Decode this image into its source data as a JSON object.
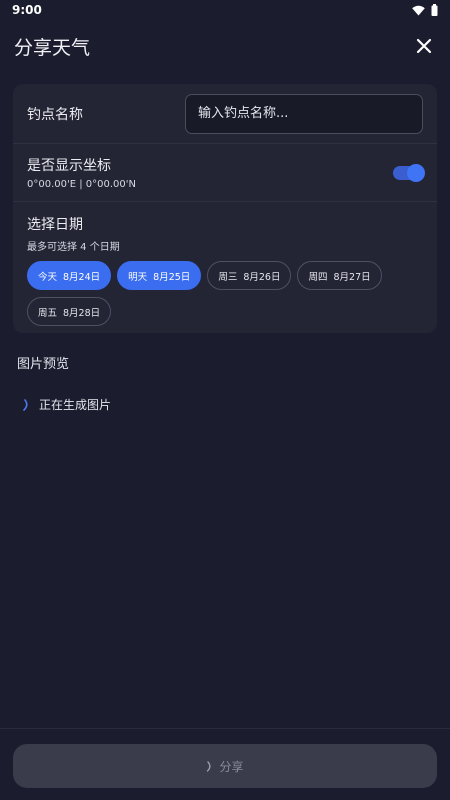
{
  "status_bar": {
    "time": "9:00",
    "icons": [
      "wifi-icon",
      "battery-icon"
    ]
  },
  "header": {
    "title": "分享天气",
    "close_icon": "close-icon"
  },
  "spot_name": {
    "label": "钓点名称",
    "placeholder": "输入钓点名称..."
  },
  "coordinates": {
    "label": "是否显示坐标",
    "value": "0°00.00'E | 0°00.00'N",
    "enabled": true
  },
  "dates": {
    "label": "选择日期",
    "hint": "最多可选择 4 个日期",
    "options": [
      {
        "day": "今天",
        "date": "8月24日",
        "selected": true
      },
      {
        "day": "明天",
        "date": "8月25日",
        "selected": true
      },
      {
        "day": "周三",
        "date": "8月26日",
        "selected": false
      },
      {
        "day": "周四",
        "date": "8月27日",
        "selected": false
      },
      {
        "day": "周五",
        "date": "8月28日",
        "selected": false
      }
    ]
  },
  "preview": {
    "title": "图片预览",
    "status": "正在生成图片"
  },
  "share_button": {
    "label": "分享"
  },
  "colors": {
    "background": "#1b1c2e",
    "card": "#232434",
    "accent": "#3b6df0",
    "disabled_button": "#3a3b4b"
  }
}
